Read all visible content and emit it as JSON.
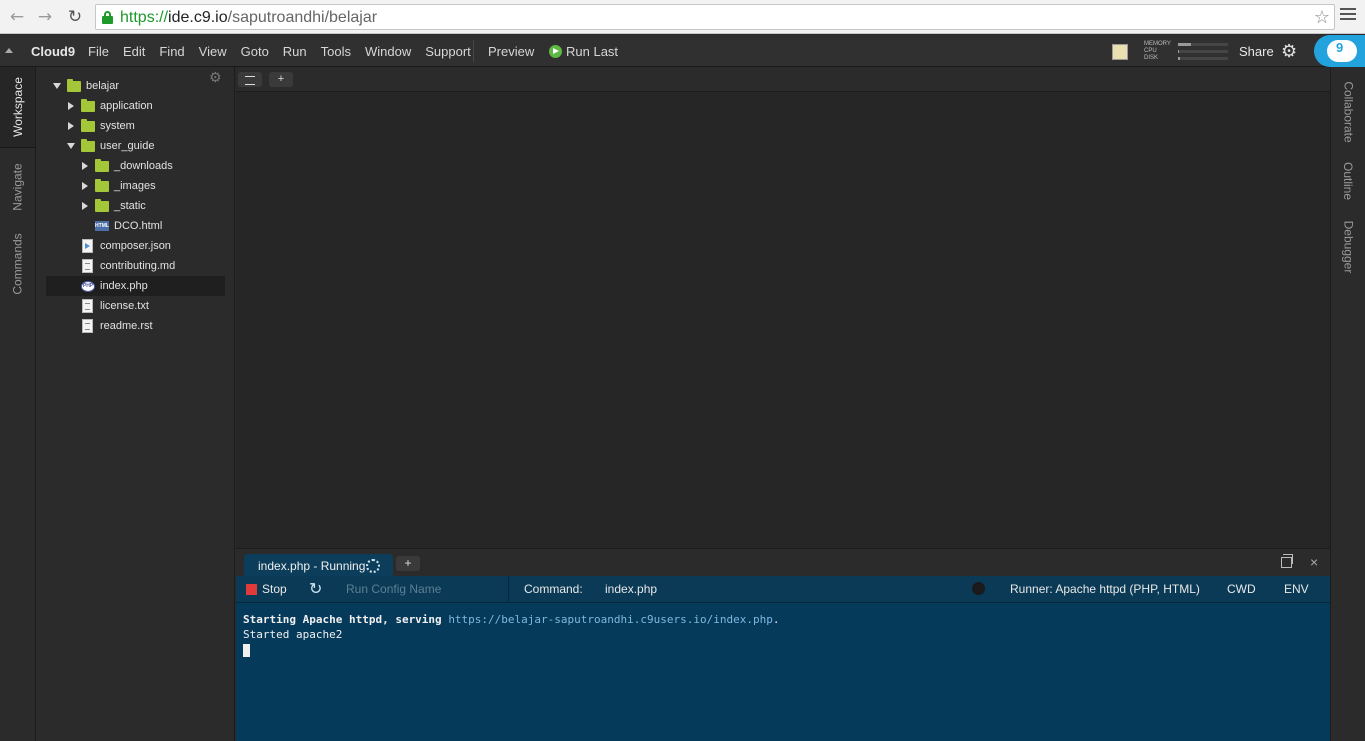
{
  "browser": {
    "url_scheme": "https://",
    "url_host": "ide.c9.io",
    "url_path": "/saputroandhi/belajar"
  },
  "menubar": {
    "brand": "Cloud9",
    "items": [
      "File",
      "Edit",
      "Find",
      "View",
      "Goto",
      "Run",
      "Tools",
      "Window",
      "Support"
    ],
    "preview": "Preview",
    "run_last": "Run Last",
    "stats": [
      {
        "label": "MEMORY",
        "fill": 0.25
      },
      {
        "label": "CPU",
        "fill": 0.02
      },
      {
        "label": "DISK",
        "fill": 0.03
      }
    ],
    "share": "Share",
    "logo_text": "9"
  },
  "left_tabs": [
    "Workspace",
    "Navigate",
    "Commands"
  ],
  "right_tabs": [
    "Collaborate",
    "Outline",
    "Debugger"
  ],
  "tree": [
    {
      "label": "belajar",
      "type": "folder",
      "expanded": true,
      "level": 0
    },
    {
      "label": "application",
      "type": "folder",
      "expanded": false,
      "level": 1
    },
    {
      "label": "system",
      "type": "folder",
      "expanded": false,
      "level": 1
    },
    {
      "label": "user_guide",
      "type": "folder",
      "expanded": true,
      "level": 1
    },
    {
      "label": "_downloads",
      "type": "folder",
      "expanded": false,
      "level": 2
    },
    {
      "label": "_images",
      "type": "folder",
      "expanded": false,
      "level": 2
    },
    {
      "label": "_static",
      "type": "folder",
      "expanded": false,
      "level": 2
    },
    {
      "label": "DCO.html",
      "type": "html",
      "level": 2
    },
    {
      "label": "composer.json",
      "type": "json",
      "level": 1
    },
    {
      "label": "contributing.md",
      "type": "doc",
      "level": 1
    },
    {
      "label": "index.php",
      "type": "php",
      "level": 1,
      "selected": true
    },
    {
      "label": "license.txt",
      "type": "doc",
      "level": 1
    },
    {
      "label": "readme.rst",
      "type": "doc",
      "level": 1
    }
  ],
  "editor": {
    "add_tab": "+"
  },
  "console": {
    "tab_label": "index.php - Running",
    "add_tab": "+",
    "close": "×",
    "stop": "Stop",
    "run_config_placeholder": "Run Config Name",
    "command_label": "Command:",
    "command_value": "index.php",
    "runner": "Runner: Apache httpd (PHP, HTML)",
    "cwd": "CWD",
    "env": "ENV",
    "output": {
      "line1_prefix": "Starting Apache httpd, serving ",
      "line1_link": "https://belajar-saputroandhi.c9users.io/index.php",
      "line1_suffix": ".",
      "line2": "Started apache2"
    }
  }
}
